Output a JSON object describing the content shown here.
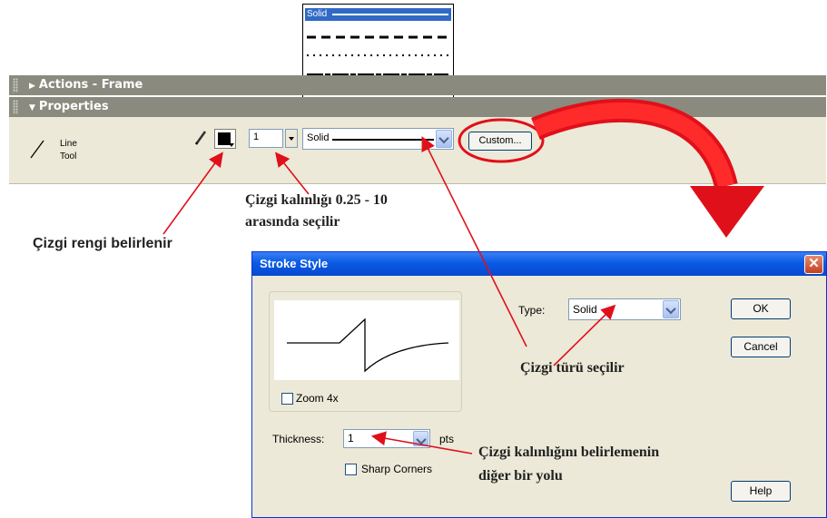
{
  "panels": {
    "actions_title": "Actions - Frame",
    "properties_title": "Properties"
  },
  "tool": {
    "line1": "Line",
    "line2": "Tool"
  },
  "stroke": {
    "width_value": "1",
    "style_value": "Solid",
    "dropdown_selected": "Solid",
    "custom_label": "Custom..."
  },
  "callouts": {
    "thickness": [
      "Çizgi kalınlığı 0.25 - 10",
      "arasında seçilir"
    ],
    "color": "Çizgi rengi belirlenir",
    "type": "Çizgi türü seçilir",
    "alt_thickness": [
      "Çizgi kalınlığını belirlemenin",
      "diğer bir yolu"
    ]
  },
  "dialog": {
    "title": "Stroke Style",
    "close_glyph": "✕",
    "zoom_label": "Zoom 4x",
    "thickness_label": "Thickness:",
    "thickness_value": "1",
    "thickness_unit": "pts",
    "sharp_label": "Sharp Corners",
    "type_label": "Type:",
    "type_value": "Solid",
    "ok_label": "OK",
    "cancel_label": "Cancel",
    "help_label": "Help"
  },
  "colors": {
    "arrow_red": "#e0101a",
    "title_blue": "#0a5be5",
    "panel_bar": "#8b8a7f"
  },
  "icons": [
    "pencil-icon",
    "expand-arrow-icon",
    "collapse-arrow-icon",
    "chevron-down-icon",
    "close-icon"
  ]
}
